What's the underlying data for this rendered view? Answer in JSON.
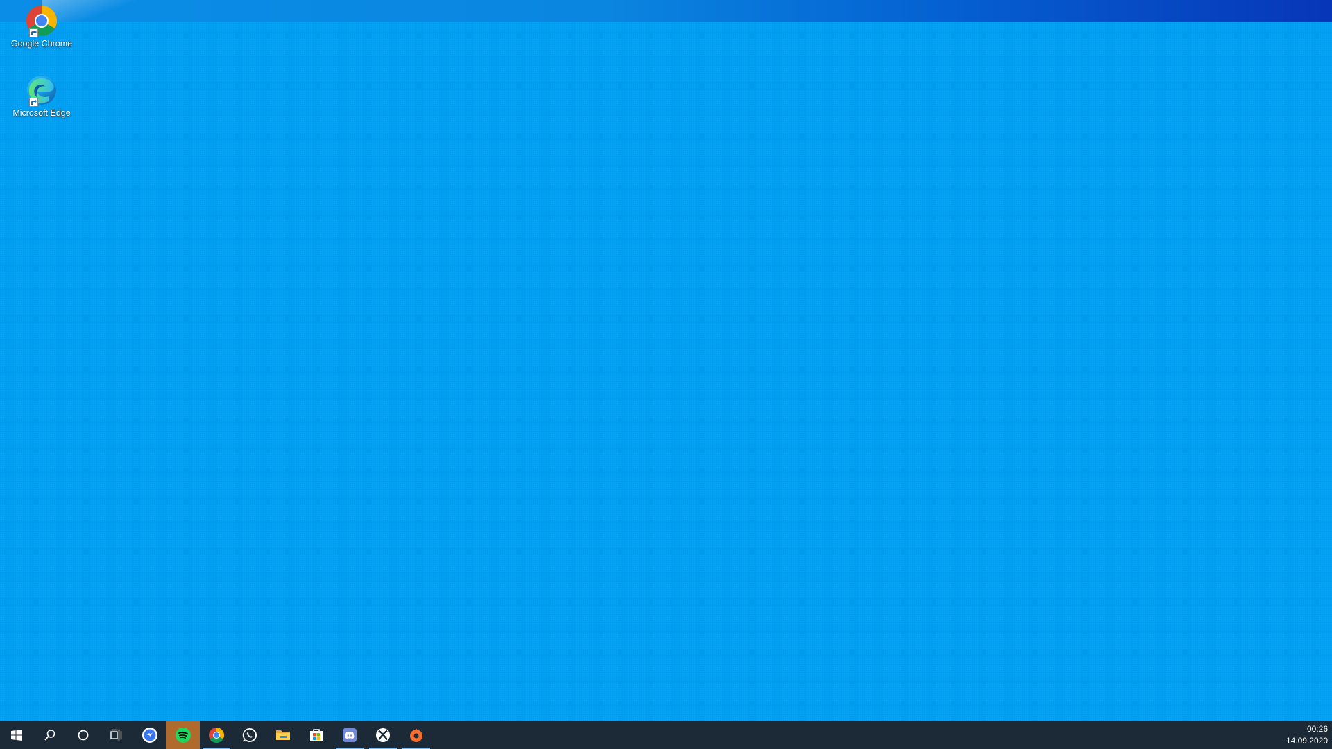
{
  "desktop": {
    "icons": [
      {
        "label": "Google Chrome",
        "icon": "chrome-icon"
      },
      {
        "label": "Microsoft Edge",
        "icon": "edge-icon"
      }
    ]
  },
  "taskbar": {
    "buttons": [
      {
        "name": "start",
        "icon": "windows-logo-icon"
      },
      {
        "name": "search",
        "icon": "search-icon"
      },
      {
        "name": "cortana",
        "icon": "circle-icon"
      },
      {
        "name": "task-view",
        "icon": "task-view-icon"
      },
      {
        "name": "signal",
        "icon": "messenger-icon"
      },
      {
        "name": "spotify",
        "icon": "spotify-icon",
        "highlighted": true
      },
      {
        "name": "chrome",
        "icon": "chrome-icon",
        "active": true
      },
      {
        "name": "whatsapp",
        "icon": "whatsapp-icon"
      },
      {
        "name": "file-explorer",
        "icon": "folder-icon"
      },
      {
        "name": "store",
        "icon": "store-icon"
      },
      {
        "name": "discord",
        "icon": "discord-icon",
        "active": true
      },
      {
        "name": "xbox",
        "icon": "xbox-icon",
        "active": true
      },
      {
        "name": "origin",
        "icon": "origin-icon",
        "active": true
      }
    ],
    "clock": {
      "time": "00:26",
      "date": "14.09.2020"
    }
  },
  "colors": {
    "desktop": "#03a2f4",
    "taskbar": "#1b2a36",
    "active_indicator": "#7fb9ea",
    "spotify_green": "#1ed760",
    "highlight": "#b06a2c"
  }
}
